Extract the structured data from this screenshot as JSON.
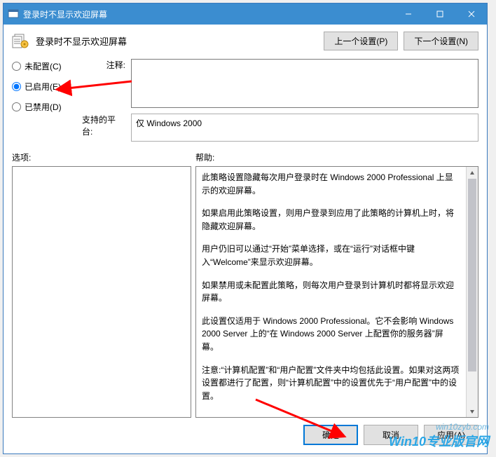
{
  "window": {
    "title": "登录时不显示欢迎屏幕"
  },
  "header": {
    "title": "登录时不显示欢迎屏幕",
    "prev_button": "上一个设置(P)",
    "next_button": "下一个设置(N)"
  },
  "radios": {
    "not_configured": "未配置(C)",
    "enabled": "已启用(E)",
    "disabled": "已禁用(D)",
    "selected": "enabled"
  },
  "labels": {
    "comment": "注释:",
    "supported": "支持的平台:",
    "options": "选项:",
    "help": "帮助:"
  },
  "fields": {
    "comment_value": "",
    "supported_value": "仅 Windows 2000"
  },
  "help_paragraphs": [
    "此策略设置隐藏每次用户登录时在 Windows 2000 Professional 上显示的欢迎屏幕。",
    "如果启用此策略设置，则用户登录到应用了此策略的计算机上时，将隐藏欢迎屏幕。",
    "用户仍旧可以通过“开始”菜单选择，或在“运行”对话框中键入“Welcome”来显示欢迎屏幕。",
    "如果禁用或未配置此策略，则每次用户登录到计算机时都将显示欢迎屏幕。",
    "此设置仅适用于 Windows 2000 Professional。它不会影响 Windows 2000 Server 上的“在 Windows 2000 Server 上配置你的服务器”屏幕。",
    "注意:“计算机配置”和“用户配置”文件夹中均包括此设置。如果对这两项设置都进行了配置，则“计算机配置”中的设置优先于“用户配置”中的设置。"
  ],
  "footer": {
    "ok": "确定",
    "cancel": "取消",
    "apply": "应用(A)"
  },
  "watermark": {
    "line1": "win10zyb.com",
    "line2": "Win10专业版官网"
  }
}
